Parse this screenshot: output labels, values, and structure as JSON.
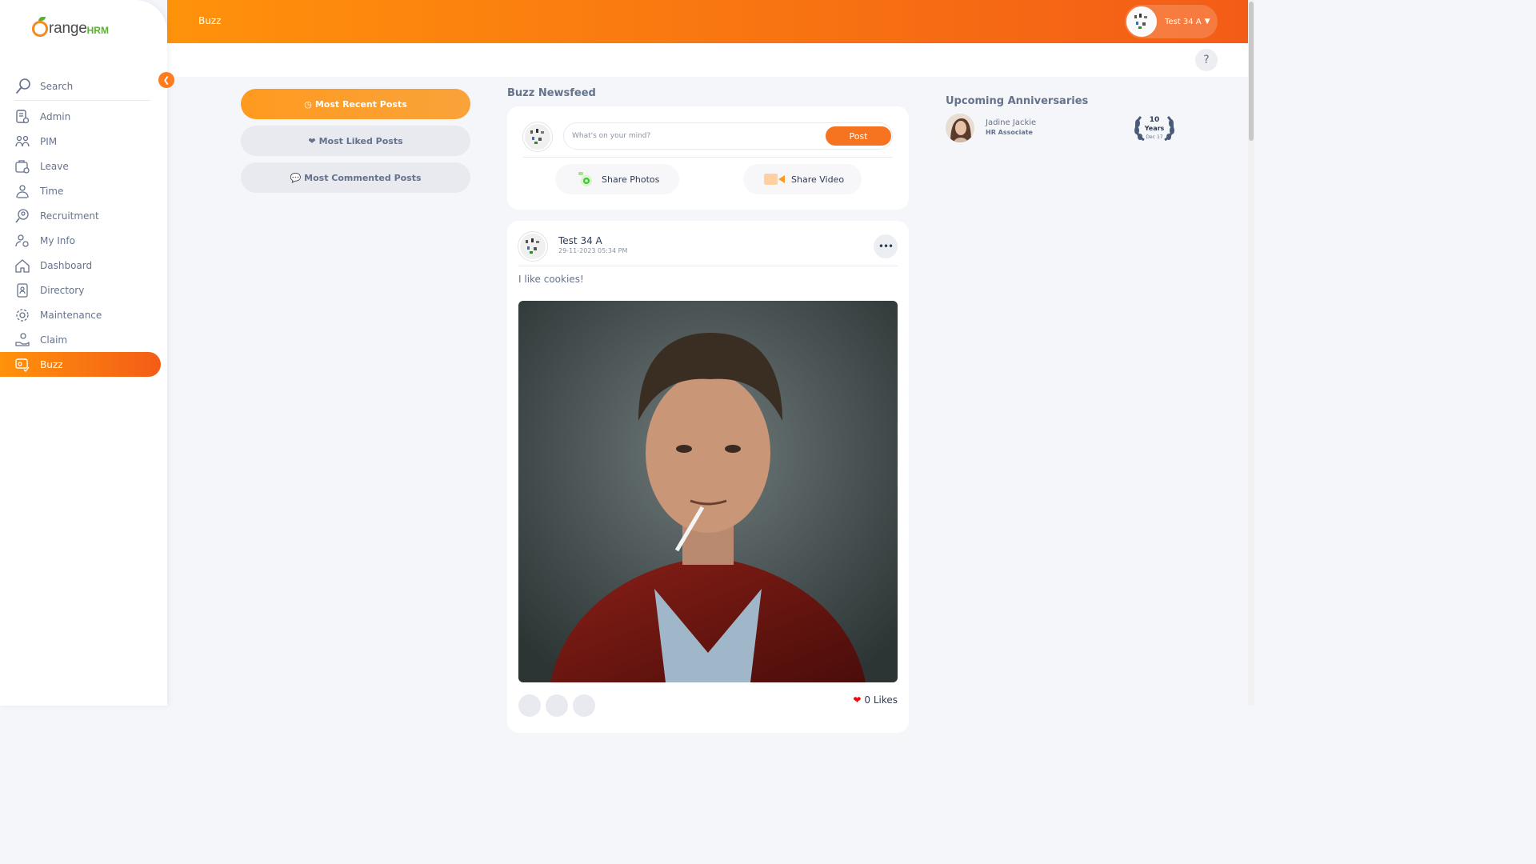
{
  "brand": {
    "word": "range",
    "suffix": "HRM"
  },
  "sidebar": {
    "search_label": "Search",
    "items": [
      {
        "label": "Admin",
        "icon": "admin-icon"
      },
      {
        "label": "PIM",
        "icon": "pim-icon"
      },
      {
        "label": "Leave",
        "icon": "leave-icon"
      },
      {
        "label": "Time",
        "icon": "time-icon"
      },
      {
        "label": "Recruitment",
        "icon": "recruitment-icon"
      },
      {
        "label": "My Info",
        "icon": "my-info-icon"
      },
      {
        "label": "Dashboard",
        "icon": "dashboard-icon"
      },
      {
        "label": "Directory",
        "icon": "directory-icon"
      },
      {
        "label": "Maintenance",
        "icon": "maintenance-icon"
      },
      {
        "label": "Claim",
        "icon": "claim-icon"
      },
      {
        "label": "Buzz",
        "icon": "buzz-icon",
        "active": true
      }
    ]
  },
  "header": {
    "title": "Buzz",
    "user_name": "Test 34 A",
    "help": "?"
  },
  "filters": [
    {
      "label": "Most Recent Posts",
      "icon": "clock-icon",
      "active": true
    },
    {
      "label": "Most Liked Posts",
      "icon": "heart-icon",
      "active": false
    },
    {
      "label": "Most Commented Posts",
      "icon": "comment-icon",
      "active": false
    }
  ],
  "feed": {
    "title": "Buzz Newsfeed",
    "composer": {
      "placeholder": "What's on your mind?",
      "post_label": "Post",
      "share_photos": "Share Photos",
      "share_video": "Share Video"
    },
    "post": {
      "author": "Test 34 A",
      "timestamp": "29-11-2023 05:34 PM",
      "text": "I like cookies!",
      "likes": "0 Likes"
    }
  },
  "anniversaries": {
    "title": "Upcoming Anniversaries",
    "items": [
      {
        "name": "Jadine Jackie",
        "role": "HR Associate",
        "years": "10",
        "years_label": "Years",
        "date": "Dec 17"
      }
    ]
  },
  "colors": {
    "accent": "#ff7b1d",
    "accent_dark": "#f35c17",
    "text": "#64728c",
    "like_red": "#eb0910"
  }
}
